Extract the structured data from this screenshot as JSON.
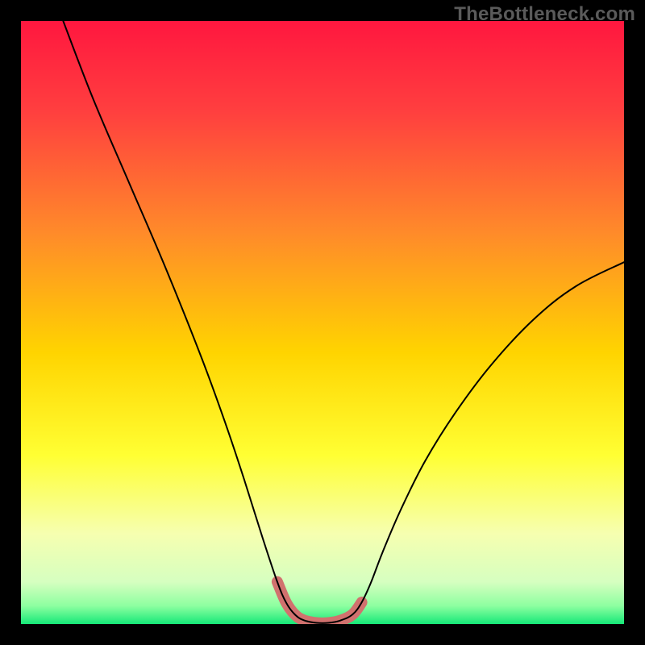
{
  "watermark": "TheBottleneck.com",
  "chart_data": {
    "type": "line",
    "title": "",
    "xlabel": "",
    "ylabel": "",
    "xlim": [
      0,
      100
    ],
    "ylim": [
      0,
      100
    ],
    "grid": false,
    "legend": false,
    "background_gradient": [
      {
        "offset": 0.0,
        "color": "#ff173f"
      },
      {
        "offset": 0.15,
        "color": "#ff3f3f"
      },
      {
        "offset": 0.35,
        "color": "#ff8a2a"
      },
      {
        "offset": 0.55,
        "color": "#ffd400"
      },
      {
        "offset": 0.72,
        "color": "#ffff33"
      },
      {
        "offset": 0.85,
        "color": "#f6ffb0"
      },
      {
        "offset": 0.93,
        "color": "#d6ffc0"
      },
      {
        "offset": 0.97,
        "color": "#8dffa0"
      },
      {
        "offset": 1.0,
        "color": "#16e878"
      }
    ],
    "series": [
      {
        "name": "curve",
        "stroke": "#000000",
        "stroke_width": 2,
        "x": [
          7,
          12,
          18,
          24,
          30,
          34,
          37,
          40,
          42.5,
          44,
          45.5,
          47,
          49,
          51,
          53,
          55,
          56.5,
          58,
          60,
          63,
          67,
          72,
          78,
          85,
          92,
          100
        ],
        "y": [
          100,
          87,
          73,
          59,
          44,
          33,
          24,
          14.5,
          7,
          3.5,
          1.5,
          0.6,
          0.2,
          0.2,
          0.6,
          1.6,
          3.6,
          6.8,
          12,
          19,
          27,
          35,
          43,
          50.5,
          56,
          60
        ]
      },
      {
        "name": "bottom-highlight",
        "stroke": "#d1716e",
        "stroke_width": 14,
        "linecap": "round",
        "x": [
          42.5,
          44,
          45.5,
          47,
          49,
          51,
          53,
          55,
          56.5
        ],
        "y": [
          7,
          3.5,
          1.5,
          0.6,
          0.2,
          0.2,
          0.6,
          1.6,
          3.6
        ]
      }
    ]
  }
}
